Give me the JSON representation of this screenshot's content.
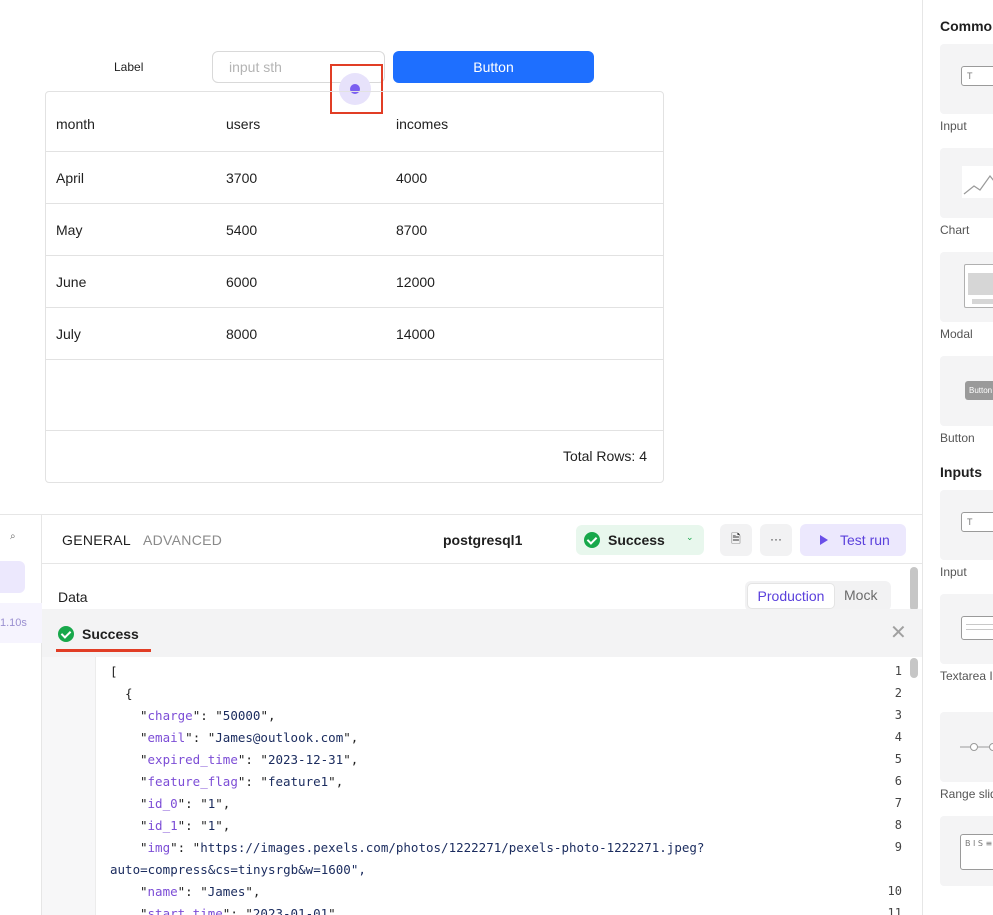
{
  "canvas": {
    "label": "Label",
    "input_placeholder": "input sth",
    "button_label": "Button",
    "table": {
      "columns": [
        "month",
        "users",
        "incomes"
      ],
      "rows": [
        [
          "April",
          "3700",
          "4000"
        ],
        [
          "May",
          "5400",
          "8700"
        ],
        [
          "June",
          "6000",
          "12000"
        ],
        [
          "July",
          "8000",
          "14000"
        ]
      ],
      "footer": "Total Rows: 4"
    }
  },
  "right_panel": {
    "common_header": "Common",
    "common_items": [
      "Input",
      "Chart",
      "Modal",
      "Button"
    ],
    "inputs_header": "Inputs",
    "input_items": [
      "Input",
      "Textarea Input",
      "Range slider",
      ""
    ],
    "button_thumb_text": "Button",
    "input_thumb_text": "T"
  },
  "query_list": {
    "item_time": "1.10s"
  },
  "query_panel": {
    "tabs": [
      "GENERAL",
      "ADVANCED"
    ],
    "query_name": "postgresql1",
    "status": "Success",
    "doc_icon": "document-icon",
    "more_icon": "more-icon",
    "test_run_label": "Test run",
    "data_label": "Data",
    "env_options": [
      "Production",
      "Mock"
    ],
    "env_selected": "Production",
    "result": {
      "status": "Success",
      "lines": [
        {
          "n": "1",
          "text": "["
        },
        {
          "n": "",
          "text": "  {"
        },
        {
          "n": "3",
          "key": "charge",
          "val": "50000"
        },
        {
          "n": "4",
          "key": "email",
          "val": "James@outlook.com"
        },
        {
          "n": "5",
          "key": "expired_time",
          "val": "2023-12-31"
        },
        {
          "n": "6",
          "key": "feature_flag",
          "val": "feature1"
        },
        {
          "n": "7",
          "key": "id_0",
          "val": "1"
        },
        {
          "n": "8",
          "key": "id_1",
          "val": "1"
        },
        {
          "n": "9",
          "key": "img",
          "val": "https://images.pexels.com/photos/1222271/pexels-photo-1222271.jpeg?",
          "cont": "auto=compress&cs=tinysrgb&w=1600\","
        },
        {
          "n": "10",
          "key": "name",
          "val": "James"
        },
        {
          "n": "11",
          "key": "start_time",
          "val": "2023-01-01"
        }
      ],
      "line2_number": "2"
    }
  }
}
